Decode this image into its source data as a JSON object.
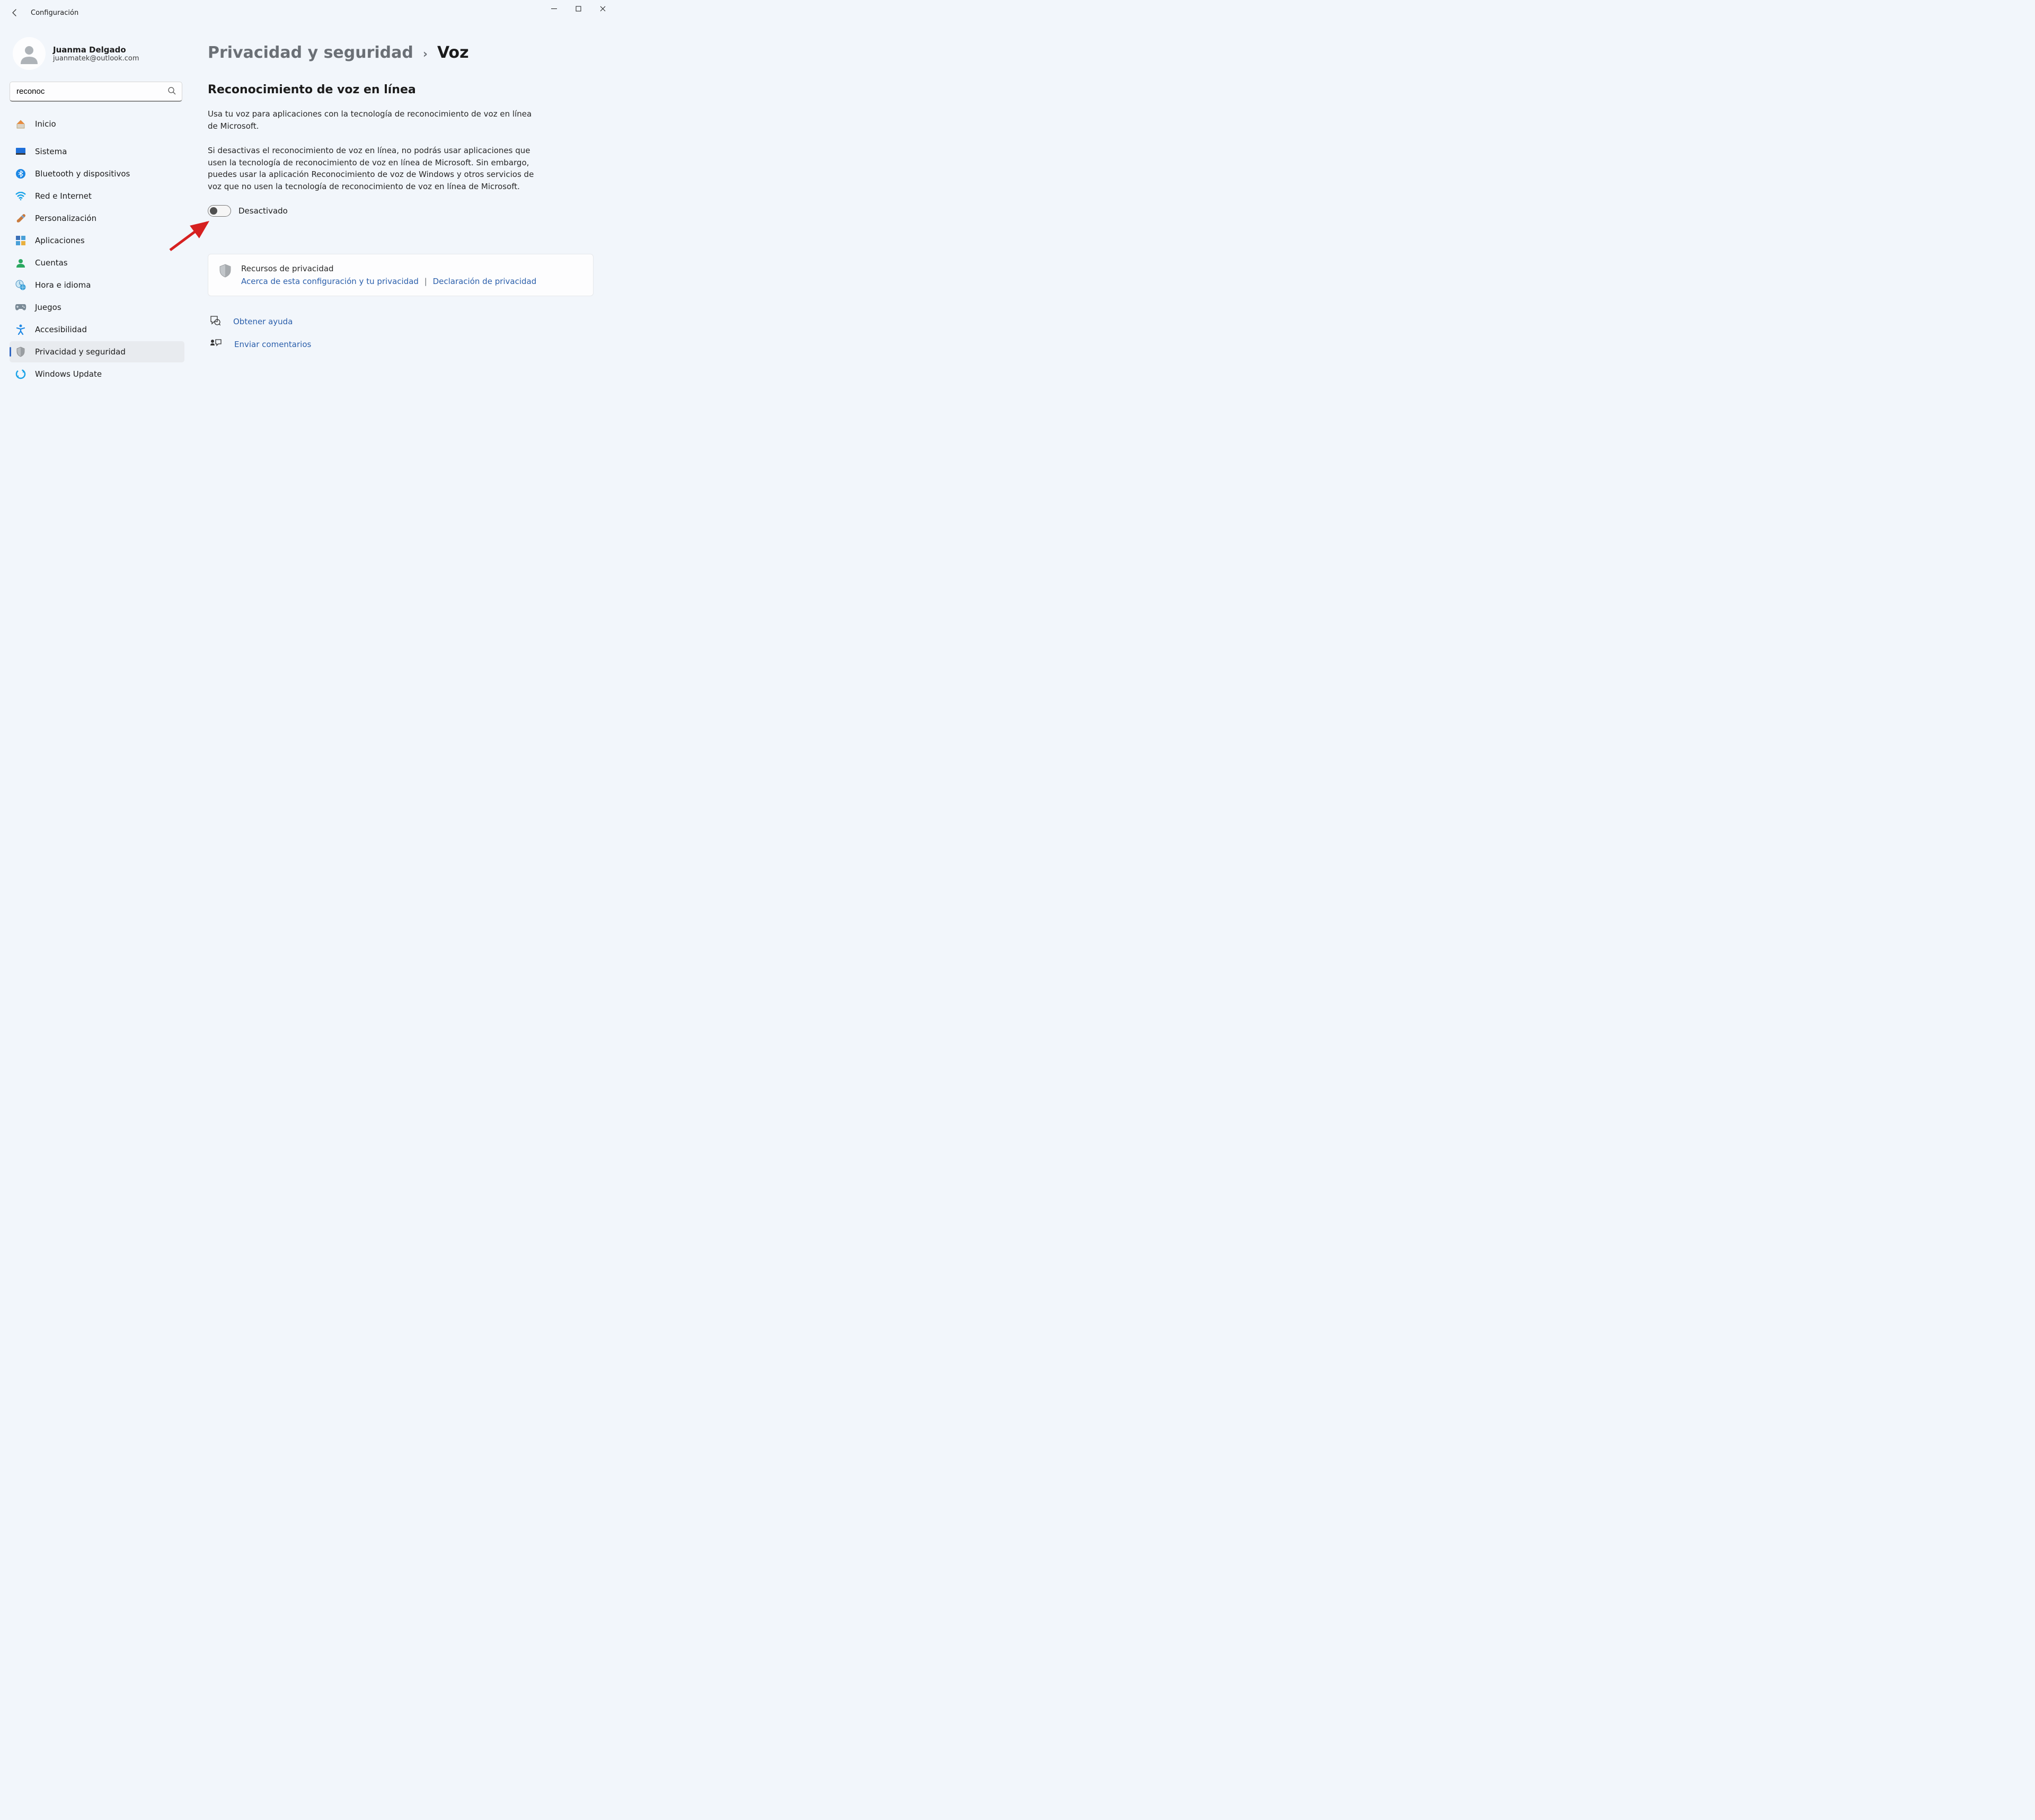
{
  "window": {
    "title": "Configuración"
  },
  "user": {
    "name": "Juanma Delgado",
    "email": "juanmatek@outlook.com"
  },
  "search": {
    "value": "reconoc"
  },
  "sidebar": {
    "items": [
      {
        "label": "Inicio"
      },
      {
        "label": "Sistema"
      },
      {
        "label": "Bluetooth y dispositivos"
      },
      {
        "label": "Red e Internet"
      },
      {
        "label": "Personalización"
      },
      {
        "label": "Aplicaciones"
      },
      {
        "label": "Cuentas"
      },
      {
        "label": "Hora e idioma"
      },
      {
        "label": "Juegos"
      },
      {
        "label": "Accesibilidad"
      },
      {
        "label": "Privacidad y seguridad"
      },
      {
        "label": "Windows Update"
      }
    ]
  },
  "breadcrumb": {
    "parent": "Privacidad y seguridad",
    "sep": "›",
    "current": "Voz"
  },
  "content": {
    "section_title": "Reconocimiento de voz en línea",
    "para1": "Usa tu voz para aplicaciones con la tecnología de reconocimiento de voz en línea de Microsoft.",
    "para2": "Si desactivas el reconocimiento de voz en línea, no podrás usar aplicaciones que usen la tecnología de reconocimiento de voz en línea de Microsoft. Sin embargo, puedes usar la aplicación Reconocimiento de voz de Windows y otros servicios de voz que no usen la tecnología de reconocimiento de voz en línea de Microsoft.",
    "toggle_label": "Desactivado"
  },
  "card": {
    "title": "Recursos de privacidad",
    "link1": "Acerca de esta configuración y tu privacidad",
    "link2": "Declaración de privacidad"
  },
  "footer": {
    "help": "Obtener ayuda",
    "feedback": "Enviar comentarios"
  }
}
